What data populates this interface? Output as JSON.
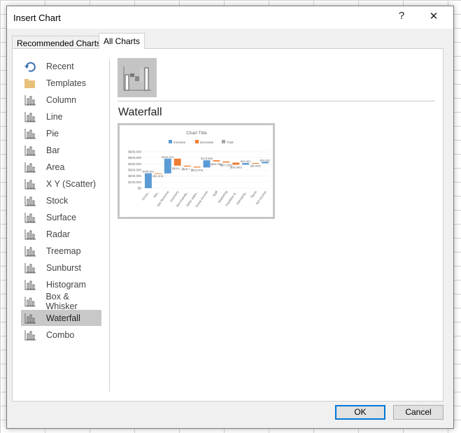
{
  "dialog": {
    "title": "Insert Chart",
    "help": "?",
    "close": "✕"
  },
  "tabs": [
    {
      "label": "Recommended Charts",
      "active": false
    },
    {
      "label": "All Charts",
      "active": true
    }
  ],
  "chart_types": [
    {
      "label": "Recent",
      "icon": "recent-icon"
    },
    {
      "label": "Templates",
      "icon": "folder-icon"
    },
    {
      "label": "Column",
      "icon": "column-chart-icon"
    },
    {
      "label": "Line",
      "icon": "line-chart-icon"
    },
    {
      "label": "Pie",
      "icon": "pie-chart-icon"
    },
    {
      "label": "Bar",
      "icon": "bar-chart-icon"
    },
    {
      "label": "Area",
      "icon": "area-chart-icon"
    },
    {
      "label": "X Y (Scatter)",
      "icon": "scatter-chart-icon"
    },
    {
      "label": "Stock",
      "icon": "stock-chart-icon"
    },
    {
      "label": "Surface",
      "icon": "surface-chart-icon"
    },
    {
      "label": "Radar",
      "icon": "radar-chart-icon"
    },
    {
      "label": "Treemap",
      "icon": "treemap-chart-icon"
    },
    {
      "label": "Sunburst",
      "icon": "sunburst-chart-icon"
    },
    {
      "label": "Histogram",
      "icon": "histogram-chart-icon"
    },
    {
      "label": "Box & Whisker",
      "icon": "box-whisker-chart-icon"
    },
    {
      "label": "Waterfall",
      "icon": "waterfall-chart-icon",
      "selected": true
    },
    {
      "label": "Combo",
      "icon": "combo-chart-icon"
    }
  ],
  "selected_heading": "Waterfall",
  "preview": {
    "title": "Chart Title",
    "legend": [
      {
        "name": "Increase",
        "color": "#5b9bd5"
      },
      {
        "name": "Decrease",
        "color": "#ed7d31"
      },
      {
        "name": "Total",
        "color": "#a5a5a5"
      }
    ],
    "yticks": [
      "$0",
      "$100,000",
      "$200,000",
      "$300,000",
      "$400,000",
      "$500,000",
      "$600,000"
    ],
    "ylim": [
      0,
      600000
    ],
    "categories": [
      "Gross...",
      "Ret...",
      "Net Revenue",
      "Inventory",
      "Merchandis...",
      "Other sales...",
      "Gross Income",
      "Staff",
      "Marketing",
      "Facilities &...",
      "Operating...",
      "Taxes",
      "Net Income"
    ],
    "bars": [
      [
        0,
        245631,
        "inc",
        "$245,631"
      ],
      [
        245631,
        243218,
        "dec",
        "($2,413)"
      ],
      [
        243219,
        486438,
        "inc",
        "$243,219"
      ],
      [
        486438,
        372000,
        "dec",
        "($114,...)"
      ],
      [
        372000,
        356000,
        "dec",
        "($16,7..)"
      ],
      [
        356000,
        341000,
        "dec",
        "($15,244)"
      ],
      [
        341000,
        460000,
        "inc",
        "$123,965"
      ],
      [
        460000,
        440000,
        "dec",
        "($26,788)"
      ],
      [
        440000,
        422000,
        "dec",
        "($17,335)"
      ],
      [
        422000,
        386000,
        "dec",
        "($36,080)"
      ],
      [
        386000,
        415000,
        "inc",
        "$29,321"
      ],
      [
        415000,
        410600,
        "dec",
        "($4,400)"
      ],
      [
        410600,
        435200,
        "inc",
        "$24,601"
      ]
    ]
  },
  "buttons": {
    "ok": "OK",
    "cancel": "Cancel"
  }
}
